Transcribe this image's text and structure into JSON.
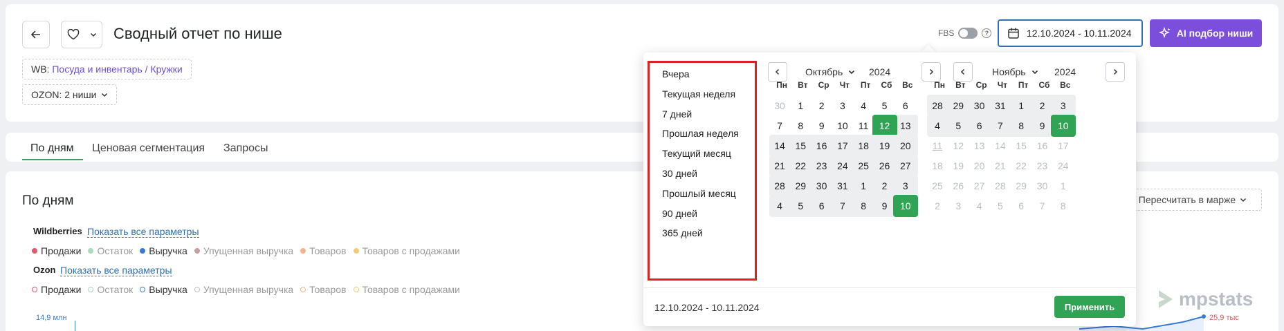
{
  "header": {
    "title": "Сводный отчет по нише",
    "wb_prefix": "WB:",
    "wb_category": "Посуда и инвентарь / Кружки",
    "ozon_label": "OZON: 2 ниши",
    "fbs_label": "FBS",
    "date_range": "12.10.2024 - 10.11.2024",
    "ai_button": "AI подбор ниши"
  },
  "tabs": [
    {
      "label": "По дням",
      "active": true
    },
    {
      "label": "Ценовая сегментация",
      "active": false
    },
    {
      "label": "Запросы",
      "active": false
    }
  ],
  "section": {
    "title": "По дням",
    "recalc": "Пересчитать в марже",
    "wb": {
      "name": "Wildberries",
      "link": "Показать все параметры",
      "legend": [
        {
          "label": "Продажи",
          "color": "#e05a6a",
          "on": true
        },
        {
          "label": "Остаток",
          "color": "#a9dcc0",
          "on": false
        },
        {
          "label": "Выручка",
          "color": "#3a7ad4",
          "on": true
        },
        {
          "label": "Упущенная выручка",
          "color": "#c8a0a0",
          "on": false
        },
        {
          "label": "Товаров",
          "color": "#f2b48a",
          "on": false
        },
        {
          "label": "Товаров с продажами",
          "color": "#f2cc7a",
          "on": false
        }
      ]
    },
    "ozon": {
      "name": "Ozon",
      "link": "Показать все параметры",
      "legend": [
        {
          "label": "Продажи",
          "color": "#e05a6a",
          "on": true
        },
        {
          "label": "Остаток",
          "color": "#a9dcc0",
          "on": false
        },
        {
          "label": "Выручка",
          "color": "#3a7ad4",
          "on": true
        },
        {
          "label": "Упущенная выручка",
          "color": "#c0c0c0",
          "on": false
        },
        {
          "label": "Товаров",
          "color": "#f2b48a",
          "on": false
        },
        {
          "label": "Товаров с продажами",
          "color": "#f2cc7a",
          "on": false
        }
      ]
    },
    "axis_left": "14,9 млн",
    "axis_right": "25,9 тыс"
  },
  "logo": "mpstats",
  "datepicker": {
    "presets": [
      "Вчера",
      "Текущая неделя",
      "7 дней",
      "Прошлая неделя",
      "Текущий месяц",
      "30 дней",
      "Прошлый месяц",
      "90 дней",
      "365 дней"
    ],
    "weekdays": [
      "Пн",
      "Вт",
      "Ср",
      "Чт",
      "Пт",
      "Сб",
      "Вс"
    ],
    "left": {
      "month": "Октябрь",
      "year": "2024",
      "weeks": [
        [
          {
            "d": "30",
            "m": 1
          },
          {
            "d": "1"
          },
          {
            "d": "2"
          },
          {
            "d": "3"
          },
          {
            "d": "4"
          },
          {
            "d": "5"
          },
          {
            "d": "6"
          }
        ],
        [
          {
            "d": "7"
          },
          {
            "d": "8"
          },
          {
            "d": "9"
          },
          {
            "d": "10"
          },
          {
            "d": "11"
          },
          {
            "d": "12",
            "s": 1,
            "r": 1
          },
          {
            "d": "13",
            "r": 1
          }
        ],
        [
          {
            "d": "14",
            "r": 1
          },
          {
            "d": "15",
            "r": 1
          },
          {
            "d": "16",
            "r": 1
          },
          {
            "d": "17",
            "r": 1
          },
          {
            "d": "18",
            "r": 1
          },
          {
            "d": "19",
            "r": 1
          },
          {
            "d": "20",
            "r": 1
          }
        ],
        [
          {
            "d": "21",
            "r": 1
          },
          {
            "d": "22",
            "r": 1
          },
          {
            "d": "23",
            "r": 1
          },
          {
            "d": "24",
            "r": 1
          },
          {
            "d": "25",
            "r": 1
          },
          {
            "d": "26",
            "r": 1
          },
          {
            "d": "27",
            "r": 1
          }
        ],
        [
          {
            "d": "28",
            "r": 1
          },
          {
            "d": "29",
            "r": 1
          },
          {
            "d": "30",
            "r": 1
          },
          {
            "d": "31",
            "r": 1
          },
          {
            "d": "1",
            "r": 1
          },
          {
            "d": "2",
            "r": 1
          },
          {
            "d": "3",
            "r": 1
          }
        ],
        [
          {
            "d": "4",
            "r": 1
          },
          {
            "d": "5",
            "r": 1
          },
          {
            "d": "6",
            "r": 1
          },
          {
            "d": "7",
            "r": 1
          },
          {
            "d": "8",
            "r": 1
          },
          {
            "d": "9",
            "r": 1
          },
          {
            "d": "10",
            "s": 1,
            "r": 1
          }
        ]
      ]
    },
    "right": {
      "month": "Ноябрь",
      "year": "2024",
      "weeks": [
        [
          {
            "d": "28",
            "r": 1
          },
          {
            "d": "29",
            "r": 1
          },
          {
            "d": "30",
            "r": 1
          },
          {
            "d": "31",
            "r": 1
          },
          {
            "d": "1",
            "r": 1
          },
          {
            "d": "2",
            "r": 1
          },
          {
            "d": "3",
            "r": 1
          }
        ],
        [
          {
            "d": "4",
            "r": 1
          },
          {
            "d": "5",
            "r": 1
          },
          {
            "d": "6",
            "r": 1
          },
          {
            "d": "7",
            "r": 1
          },
          {
            "d": "8",
            "r": 1
          },
          {
            "d": "9",
            "r": 1
          },
          {
            "d": "10",
            "s": 1,
            "r": 1
          }
        ],
        [
          {
            "d": "11",
            "t": 1,
            "m": 1
          },
          {
            "d": "12",
            "m": 1
          },
          {
            "d": "13",
            "m": 1
          },
          {
            "d": "14",
            "m": 1
          },
          {
            "d": "15",
            "m": 1
          },
          {
            "d": "16",
            "m": 1
          },
          {
            "d": "17",
            "m": 1
          }
        ],
        [
          {
            "d": "18",
            "m": 1
          },
          {
            "d": "19",
            "m": 1
          },
          {
            "d": "20",
            "m": 1
          },
          {
            "d": "21",
            "m": 1
          },
          {
            "d": "22",
            "m": 1
          },
          {
            "d": "23",
            "m": 1
          },
          {
            "d": "24",
            "m": 1
          }
        ],
        [
          {
            "d": "25",
            "m": 1
          },
          {
            "d": "26",
            "m": 1
          },
          {
            "d": "27",
            "m": 1
          },
          {
            "d": "28",
            "m": 1
          },
          {
            "d": "29",
            "m": 1
          },
          {
            "d": "30",
            "m": 1
          },
          {
            "d": "1",
            "m": 1
          }
        ],
        [
          {
            "d": "2",
            "m": 1
          },
          {
            "d": "3",
            "m": 1
          },
          {
            "d": "4",
            "m": 1
          },
          {
            "d": "5",
            "m": 1
          },
          {
            "d": "6",
            "m": 1
          },
          {
            "d": "7",
            "m": 1
          },
          {
            "d": "8",
            "m": 1
          }
        ]
      ]
    },
    "footer_range": "12.10.2024 - 10.11.2024",
    "apply": "Применить"
  }
}
